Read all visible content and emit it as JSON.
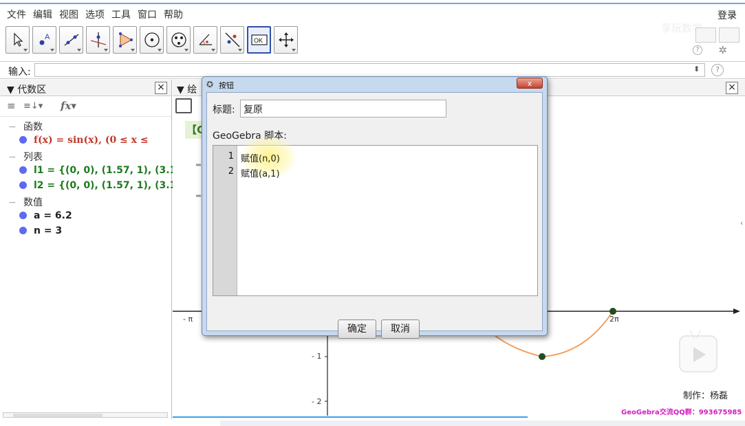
{
  "menu": [
    "文件",
    "编辑",
    "视图",
    "选项",
    "工具",
    "窗口",
    "帮助"
  ],
  "login_label": "登录",
  "watermark_top": "享玩数学",
  "toolbar": {
    "tools": [
      {
        "name": "move-tool",
        "icon": "arrow-icon"
      },
      {
        "name": "point-tool",
        "icon": "point-icon"
      },
      {
        "name": "line-tool",
        "icon": "line-icon"
      },
      {
        "name": "perpendicular-tool",
        "icon": "perpendicular-icon"
      },
      {
        "name": "polygon-tool",
        "icon": "polygon-icon"
      },
      {
        "name": "circle-tool",
        "icon": "circle-icon"
      },
      {
        "name": "ellipse-tool",
        "icon": "ellipse-icon"
      },
      {
        "name": "angle-tool",
        "icon": "angle-icon"
      },
      {
        "name": "reflect-tool",
        "icon": "reflect-icon"
      },
      {
        "name": "button-tool",
        "icon": "ok-button-icon",
        "label": "OK",
        "active": true
      },
      {
        "name": "move-graphics-tool",
        "icon": "move-cross-icon"
      }
    ]
  },
  "input_bar": {
    "label": "输入:",
    "value": "",
    "spin_symbol": "⬍",
    "help_symbol": "?"
  },
  "algebra": {
    "title": "代数区",
    "close": "×",
    "categories": [
      {
        "label": "函数",
        "items": [
          {
            "text": "f(x)  =  sin(x),     (0 ≤ x ≤",
            "color": "#c0392b"
          }
        ]
      },
      {
        "label": "列表",
        "items": [
          {
            "text": "l1 = {(0, 0), (1.57, 1), (3.14, 0",
            "color": "#1e7a1e"
          },
          {
            "text": "l2 = {(0, 0), (1.57, 1), (3.14, 0",
            "color": "#1e7a1e"
          }
        ]
      },
      {
        "label": "数值",
        "items": [
          {
            "text": "a = 6.2",
            "color": "#111111"
          },
          {
            "text": "n = 3",
            "color": "#111111"
          }
        ]
      }
    ],
    "tool_symbols": {
      "sort": "≡",
      "order": "≡↓▾",
      "fx": "fx▾"
    }
  },
  "graphics": {
    "title": "绘",
    "close": "×",
    "green_label": "【G",
    "ticks": {
      "neg_pi": "- π",
      "two_pi": "2π",
      "neg_one": "- 1",
      "neg_two": "- 2"
    }
  },
  "dialog": {
    "title": "按钮",
    "close_label": "x",
    "caption_label": "标题:",
    "caption_value": "复原",
    "script_label": "GeoGebra 脚本:",
    "lines": [
      {
        "num": "1",
        "code": "赋值(n,0)"
      },
      {
        "num": "2",
        "code": "赋值(a,1)"
      }
    ],
    "ok_label": "确定",
    "cancel_label": "取消"
  },
  "overlay": {
    "credit": "制作：杨磊",
    "qq": "GeoGebra交流QQ群：993675985"
  },
  "colors": {
    "accent_blue": "#2f4fa8",
    "function_red": "#c0392b",
    "list_green": "#1e7a1e",
    "curve_orange": "#f0a060",
    "dot_blue": "#5b6cf0"
  }
}
